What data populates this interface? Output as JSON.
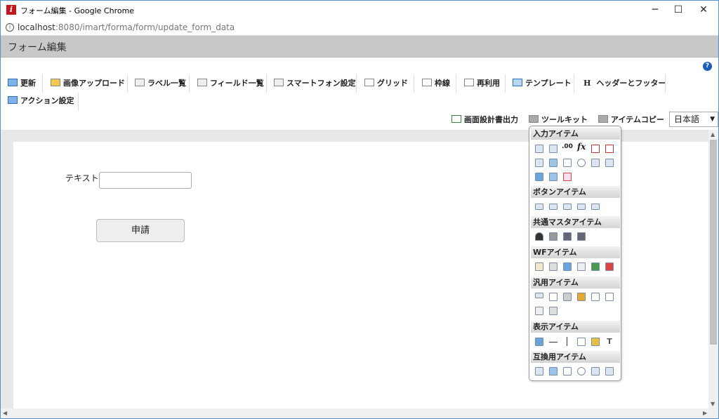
{
  "window": {
    "title": "フォーム編集 - Google Chrome",
    "app_icon": "i",
    "controls": [
      "─",
      "☐",
      "✕"
    ]
  },
  "address": {
    "host": "localhost",
    "path": ":8080/imart/forma/form/update_form_data"
  },
  "header": {
    "title": "フォーム編集"
  },
  "help": "?",
  "toolbar": {
    "items": [
      "更新",
      "画像アップロード",
      "ラベル一覧",
      "フィールド一覧",
      "スマートフォン設定",
      "グリッド",
      "枠線",
      "再利用",
      "テンプレート",
      "ヘッダーとフッター",
      "アクション設定"
    ],
    "header_prefix": "H"
  },
  "sub_toolbar": {
    "items": [
      "画面設計書出力",
      "ツールキット",
      "アイテムコピー"
    ]
  },
  "language": {
    "selected": "日本語"
  },
  "form": {
    "text_label": "テキスト",
    "submit_label": "申請"
  },
  "toolkit": {
    "sections": [
      "入力アイテム",
      "ボタンアイテム",
      "共通マスタアイテム",
      "WFアイテム",
      "汎用アイテム",
      "表示アイテム",
      "互換用アイテム"
    ],
    "fx": "fx",
    "decimal": ".00"
  }
}
